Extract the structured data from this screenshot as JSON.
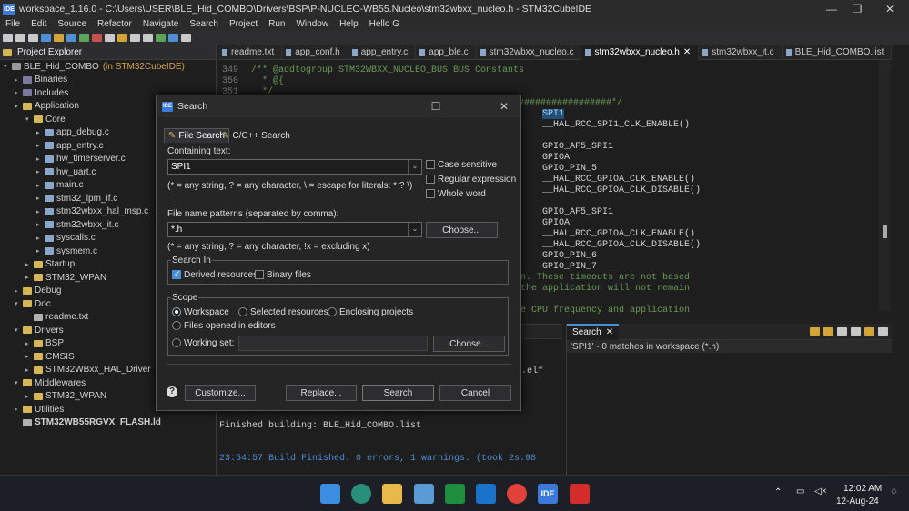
{
  "titlebar": {
    "text": "workspace_1.16.0 - C:\\Users\\USER\\BLE_Hid_COMBO\\Drivers\\BSP\\P-NUCLEO-WB55.Nucleo\\stm32wbxx_nucleo.h - STM32CubeIDE",
    "icon_text": "IDE"
  },
  "menu": [
    "File",
    "Edit",
    "Source",
    "Refactor",
    "Navigate",
    "Search",
    "Project",
    "Run",
    "Window",
    "Help",
    "Hello G"
  ],
  "explorer": {
    "title": "Project Explorer",
    "items": [
      {
        "label": "BLE_Hid_COMBO",
        "suffix": "(in STM32CubeIDE)"
      },
      {
        "label": "Binaries"
      },
      {
        "label": "Includes"
      },
      {
        "label": "Application"
      },
      {
        "label": "Core"
      },
      {
        "label": "app_debug.c"
      },
      {
        "label": "app_entry.c"
      },
      {
        "label": "hw_timerserver.c"
      },
      {
        "label": "hw_uart.c"
      },
      {
        "label": "main.c"
      },
      {
        "label": "stm32_lpm_if.c"
      },
      {
        "label": "stm32wbxx_hal_msp.c"
      },
      {
        "label": "stm32wbxx_it.c"
      },
      {
        "label": "syscalls.c"
      },
      {
        "label": "sysmem.c"
      },
      {
        "label": "Startup"
      },
      {
        "label": "STM32_WPAN"
      },
      {
        "label": "Debug"
      },
      {
        "label": "Doc"
      },
      {
        "label": "readme.txt"
      },
      {
        "label": "Drivers"
      },
      {
        "label": "BSP"
      },
      {
        "label": "CMSIS"
      },
      {
        "label": "STM32WBxx_HAL_Driver"
      },
      {
        "label": "Middlewares"
      },
      {
        "label": "STM32_WPAN"
      },
      {
        "label": "Utilities"
      },
      {
        "label": "STM32WB55RGVX_FLASH.ld"
      }
    ]
  },
  "editor_tabs": [
    "readme.txt",
    "app_conf.h",
    "app_entry.c",
    "app_ble.c",
    "stm32wbxx_nucleo.c",
    "stm32wbxx_nucleo.h",
    "stm32wbxx_it.c",
    "BLE_Hid_COMBO.list"
  ],
  "editor": {
    "line_numbers": [
      "349",
      "350",
      "351"
    ],
    "top_lines": [
      "/** @addtogroup STM32WBXX_NUCLEO_BUS BUS Constants",
      "  * @{",
      "  */"
    ],
    "right_lines": [
      "#################*/",
      "SPI1",
      "__HAL_RCC_SPI1_CLK_ENABLE()",
      "",
      "GPIO_AF5_SPI1",
      "GPIOA",
      "GPIO_PIN_5",
      "__HAL_RCC_GPIOA_CLK_ENABLE()",
      "__HAL_RCC_GPIOA_CLK_DISABLE()",
      "",
      "GPIO_AF5_SPI1",
      "GPIOA",
      "__HAL_RCC_GPIOA_CLK_ENABLE()",
      "__HAL_RCC_GPIOA_CLK_DISABLE()",
      "GPIO_PIN_6",
      "GPIO_PIN_7",
      "n. These timeouts are not based",
      "the application will not remain",
      "",
      "e CPU frequency and application"
    ]
  },
  "console": {
    "elf_line": ".elf",
    "finished": "Finished building: BLE_Hid_COMBO.list",
    "build": "23:54:57 Build Finished. 0 errors, 1 warnings. (took 2s.98"
  },
  "search_view": {
    "tab": "Search",
    "result": "'SPI1' - 0 matches in workspace (*.h)"
  },
  "dialog": {
    "title": "Search",
    "tab_file": "File Search",
    "tab_cpp": "C/C++ Search",
    "containing_label": "Containing text:",
    "containing_value": "SPI1",
    "containing_hint": "(* = any string, ? = any character, \\ = escape for literals: * ? \\)",
    "case_sensitive": "Case sensitive",
    "regex": "Regular expression",
    "whole_word": "Whole word",
    "patterns_label": "File name patterns (separated by comma):",
    "patterns_value": "*.h",
    "choose": "Choose...",
    "patterns_hint": "(* = any string, ? = any character, !x = excluding x)",
    "search_in_label": "Search In",
    "derived": "Derived resources",
    "binary": "Binary files",
    "scope_label": "Scope",
    "workspace": "Workspace",
    "selected": "Selected resources",
    "enclosing": "Enclosing projects",
    "open_editors": "Files opened in editors",
    "working_set": "Working set:",
    "choose2": "Choose...",
    "customize": "Customize...",
    "replace": "Replace...",
    "search": "Search",
    "cancel": "Cancel",
    "help": "?"
  },
  "taskbar": {
    "time": "12:02 AM",
    "date": "12-Aug-24"
  }
}
